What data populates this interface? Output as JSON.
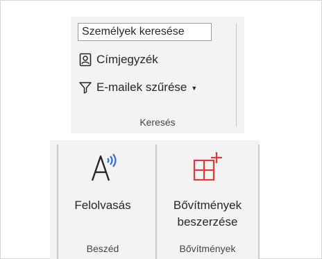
{
  "search_group": {
    "search_field_value": "Személyek keresése",
    "address_book_label": "Címjegyzék",
    "filter_email_label": "E-mailek szűrése",
    "group_label": "Keresés"
  },
  "speech_group": {
    "read_aloud_label": "Felolvasás",
    "group_label": "Beszéd"
  },
  "addins_group": {
    "get_addins_line1": "Bővítmények",
    "get_addins_line2": "beszerzése",
    "group_label": "Bővítmények"
  },
  "icons": {
    "address_book": "address-book-icon",
    "filter": "filter-icon",
    "read_aloud": "read-aloud-icon",
    "get_addins": "get-addins-icon"
  },
  "colors": {
    "addins_icon": "#e03a3e",
    "ribbon_bg": "#f3f3f3"
  }
}
